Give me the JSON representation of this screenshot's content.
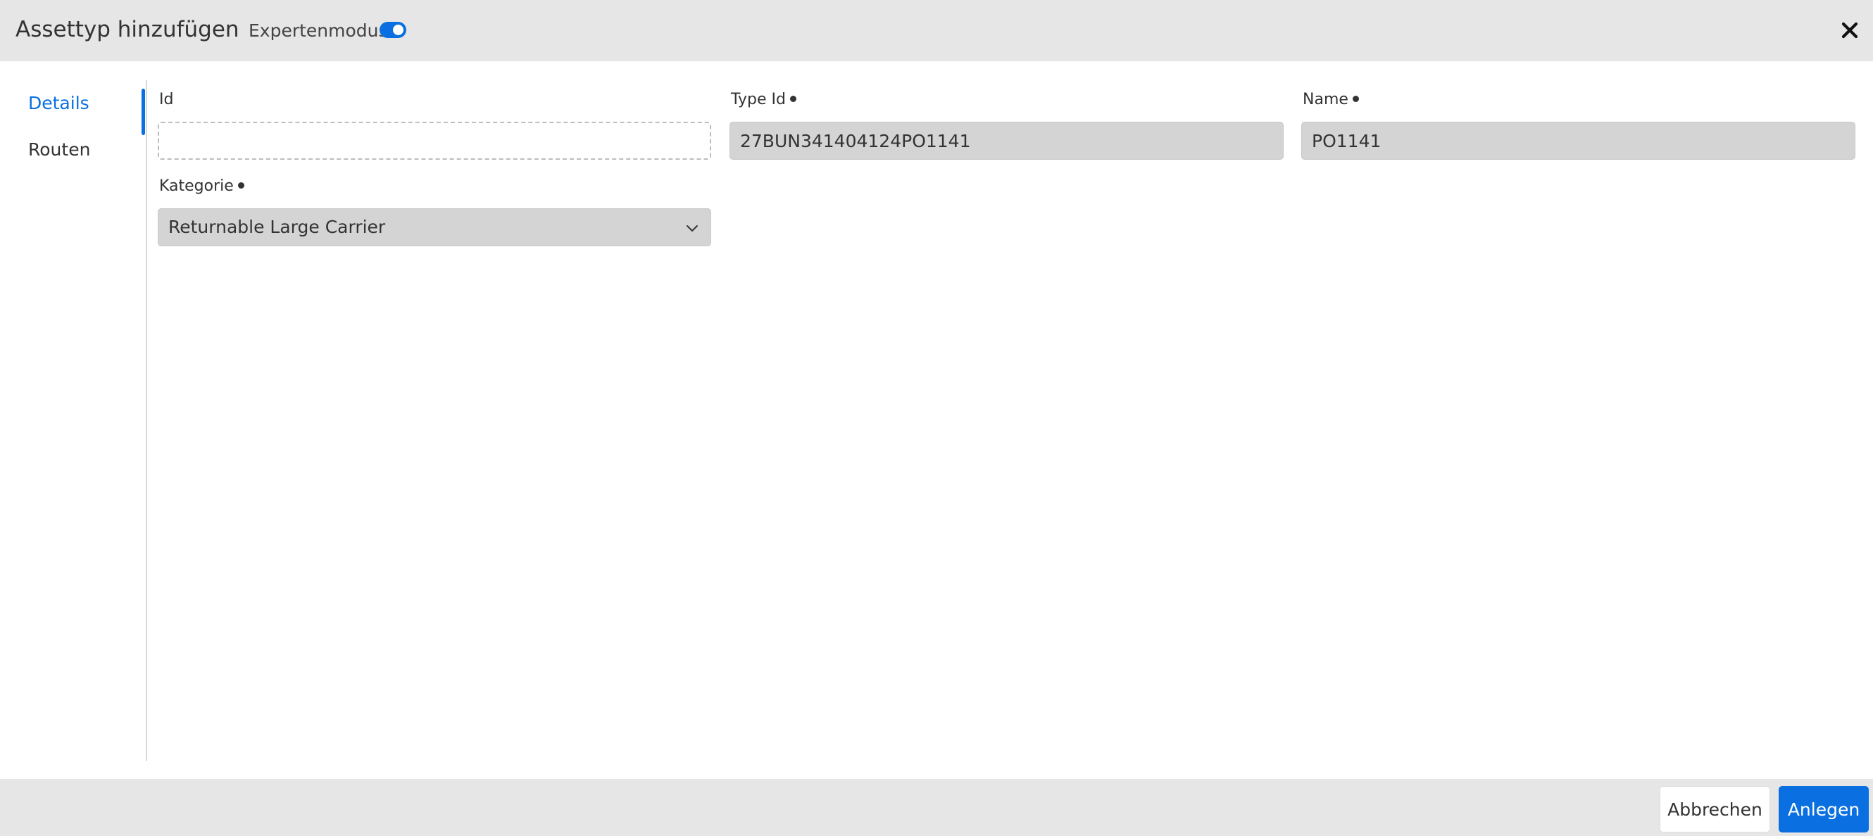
{
  "header": {
    "title": "Assettyp hinzufügen",
    "expert_mode_label": "Expertenmodus",
    "expert_mode_enabled": true
  },
  "sidenav": {
    "items": [
      {
        "label": "Details",
        "active": true
      },
      {
        "label": "Routen",
        "active": false
      }
    ]
  },
  "form": {
    "id": {
      "label": "Id",
      "value": "",
      "required": false
    },
    "type_id": {
      "label": "Type Id",
      "value": "27BUN341404124PO1141",
      "required": true
    },
    "name": {
      "label": "Name",
      "value": "PO1141",
      "required": true
    },
    "category": {
      "label": "Kategorie",
      "value": "Returnable Large Carrier",
      "required": true
    }
  },
  "footer": {
    "cancel_label": "Abbrechen",
    "create_label": "Anlegen"
  },
  "colors": {
    "accent": "#0a6fe0",
    "header_bg": "#e6e6e6",
    "input_bg": "#d4d4d4"
  },
  "icons": {
    "close": "close-icon",
    "dropdown": "chevron-down-icon",
    "required": "required-dot-icon"
  }
}
